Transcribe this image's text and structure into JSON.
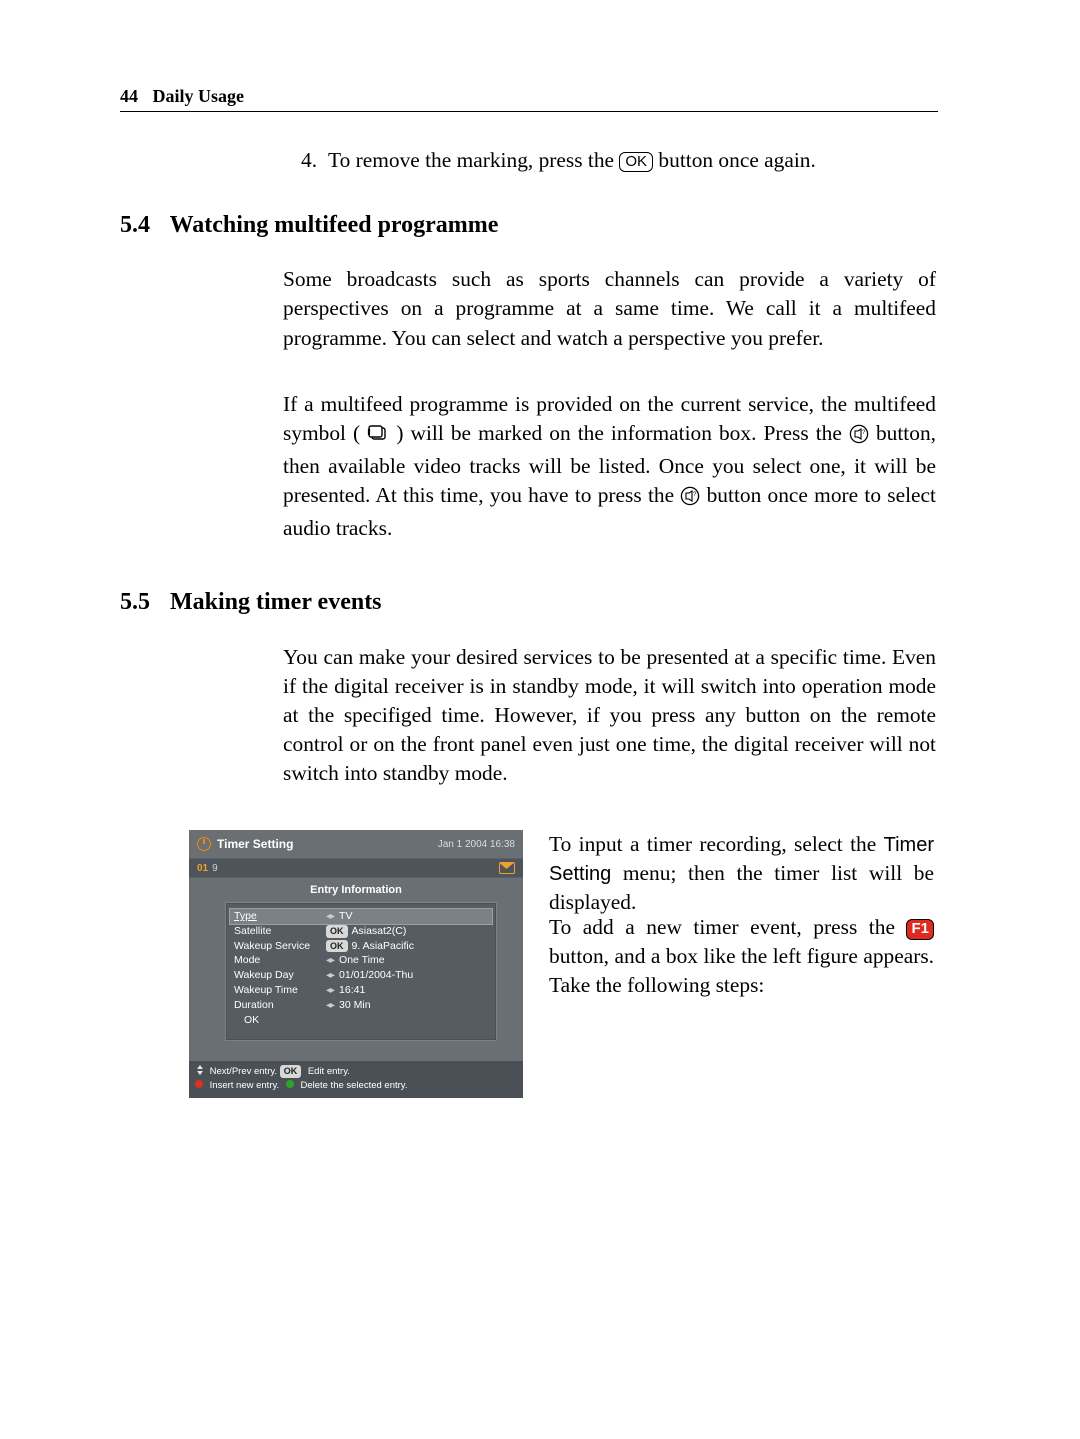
{
  "header": {
    "page_num": "44",
    "chapter": "Daily Usage"
  },
  "step4": {
    "num": "4.",
    "text_a": "To remove the marking, press the ",
    "ok": "OK",
    "text_b": " button once again."
  },
  "sec54": {
    "num": "5.4",
    "title": "Watching multifeed programme",
    "p1": "Some broadcasts such as sports channels can provide a variety of perspectives on a programme at a same time. We call it a multifeed programme. You can select and watch a perspective you prefer.",
    "p2a": "If a multifeed programme is provided on the current service, the multifeed symbol (",
    "p2b": ") will be marked on the information box. Press the ",
    "p2c": " button, then available video tracks will be listed. Once you select one, it will be presented. At this time, you have to press the ",
    "p2d": " button once more to select audio tracks."
  },
  "sec55": {
    "num": "5.5",
    "title": "Making timer events",
    "p1": "You can make your desired services to be presented at a specific time. Even if the digital receiver is in standby mode, it will switch into operation mode at the specifiged time. However, if you press any button on the remote control or on the front panel even just one time, the digital receiver will not switch into standby mode.",
    "rt1a": "To input a timer recording, select the ",
    "menu_name": "Timer Setting",
    "rt1b": " menu; then the timer list will be displayed.",
    "rt2a": "To add a new timer event, press the ",
    "f1": "F1",
    "rt2b": " button, and a box like the left figure appears. Take the following steps:"
  },
  "shot": {
    "title": "Timer Setting",
    "datetime": "Jan 1 2004 16:38",
    "chnum": "01",
    "chlist": "9",
    "entry_title": "Entry Information",
    "rows": [
      {
        "label": "Type",
        "value": "TV",
        "arrows": true,
        "selected": true,
        "typelbl": true
      },
      {
        "label": "Satellite",
        "value": "Asiasat2(C)",
        "ok": true
      },
      {
        "label": "Wakeup Service",
        "value": "9. AsiaPacific",
        "ok": true
      },
      {
        "label": "Mode",
        "value": "One Time",
        "arrows": true
      },
      {
        "label": "Wakeup Day",
        "value": "01/01/2004-Thu",
        "arrows": true
      },
      {
        "label": "Wakeup Time",
        "value": "16:41",
        "arrows": true
      },
      {
        "label": "Duration",
        "value": "30 Min",
        "arrows": true
      },
      {
        "label": "OK",
        "value": "",
        "indent": true
      }
    ],
    "foot1a": "Next/Prev entry. ",
    "foot_ok": "OK",
    "foot1b": " Edit entry.",
    "foot2a": "Insert new entry. ",
    "foot2b": "Delete the selected entry."
  }
}
